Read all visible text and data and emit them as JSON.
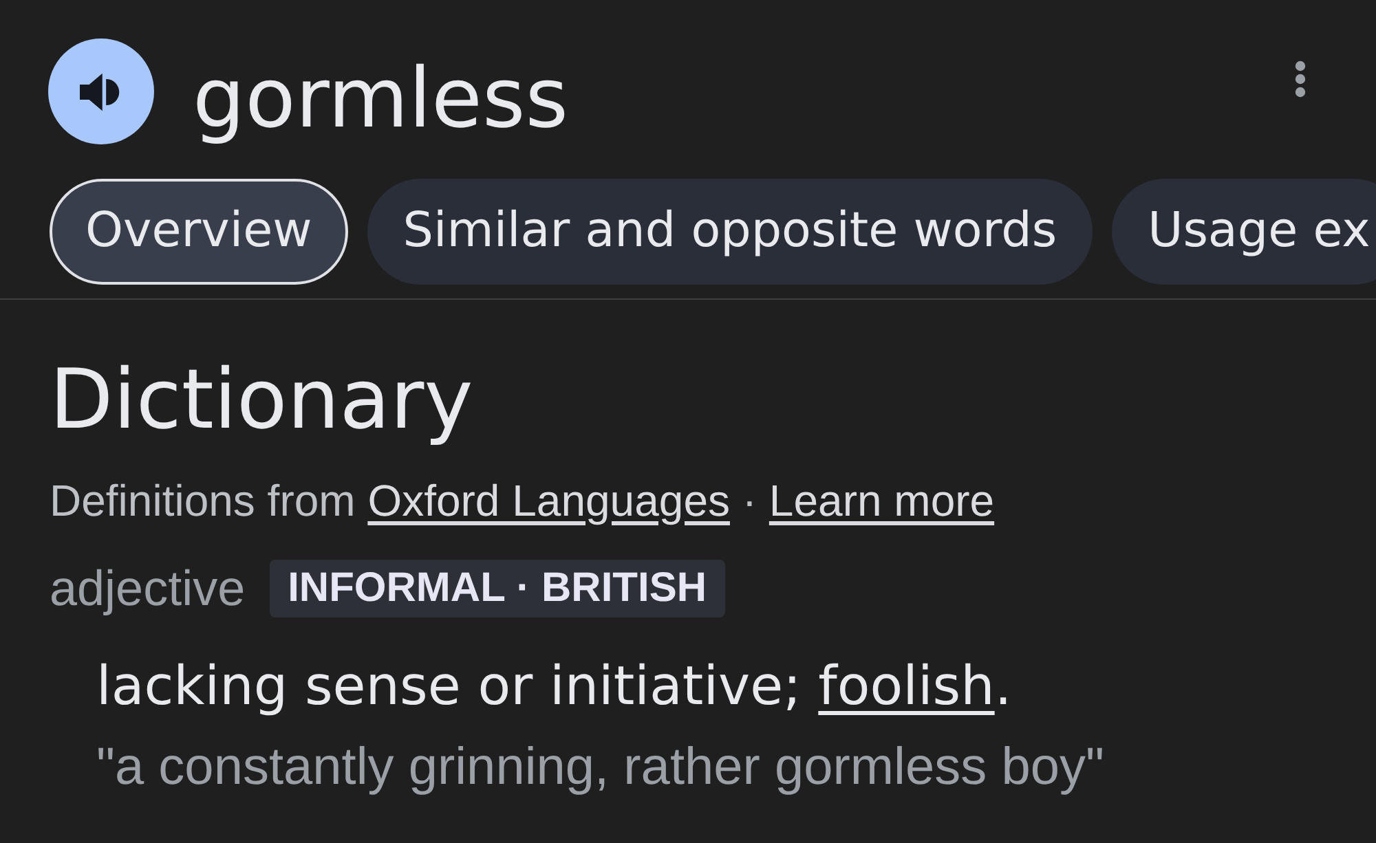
{
  "header": {
    "word": "gormless"
  },
  "tabs": [
    {
      "label": "Overview",
      "selected": true
    },
    {
      "label": "Similar and opposite words",
      "selected": false
    },
    {
      "label": "Usage ex",
      "selected": false
    }
  ],
  "dictionary": {
    "title": "Dictionary",
    "source": {
      "prefix": "Definitions from",
      "link": "Oxford Languages",
      "separator": "·",
      "learn_more": "Learn more"
    },
    "entry": {
      "part_of_speech": "adjective",
      "register": "INFORMAL · BRITISH",
      "definition": {
        "text": "lacking sense or initiative;",
        "link": "foolish",
        "end": "."
      },
      "example": "\"a constantly grinning, rather gormless boy\""
    }
  }
}
